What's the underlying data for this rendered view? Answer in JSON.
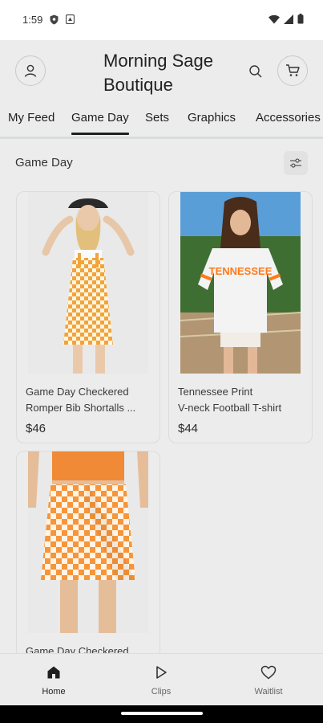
{
  "status_bar": {
    "time": "1:59"
  },
  "header": {
    "store_title": "Morning Sage Boutique"
  },
  "tabs": [
    {
      "label": "My Feed",
      "active": false
    },
    {
      "label": "Game Day",
      "active": true
    },
    {
      "label": "Sets",
      "active": false
    },
    {
      "label": "Graphics",
      "active": false
    },
    {
      "label": "Accessories",
      "active": false
    }
  ],
  "section": {
    "title": "Game Day"
  },
  "products": [
    {
      "name_line1": "Game Day Checkered",
      "name_line2": "Romper Bib Shortalls ...",
      "price": "$46"
    },
    {
      "name_line1": "Tennessee Print",
      "name_line2": "V-neck Football T-shirt",
      "price": "$44",
      "shirt_text": "TENNESSEE"
    },
    {
      "name_line1": "Game Day Checkered",
      "name_line2": "",
      "price": ""
    }
  ],
  "bottom_nav": [
    {
      "label": "Home",
      "icon": "home-icon",
      "active": true
    },
    {
      "label": "Clips",
      "icon": "play-icon",
      "active": false
    },
    {
      "label": "Waitlist",
      "icon": "heart-icon",
      "active": false
    }
  ],
  "colors": {
    "background": "#ececec",
    "checker_orange": "#f2a33a",
    "tennessee_orange": "#ff7a1a"
  }
}
